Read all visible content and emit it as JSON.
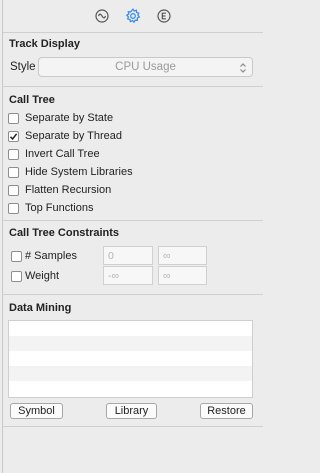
{
  "tabs": [
    {
      "icon": "waveform-icon",
      "active": false
    },
    {
      "icon": "gear-icon",
      "active": true
    },
    {
      "icon": "info-e-icon",
      "active": false
    }
  ],
  "track_display": {
    "title": "Track Display",
    "style_label": "Style",
    "style_value": "CPU Usage"
  },
  "call_tree": {
    "title": "Call Tree",
    "options": [
      {
        "label": "Separate by State",
        "checked": false
      },
      {
        "label": "Separate by Thread",
        "checked": true
      },
      {
        "label": "Invert Call Tree",
        "checked": false
      },
      {
        "label": "Hide System Libraries",
        "checked": false
      },
      {
        "label": "Flatten Recursion",
        "checked": false
      },
      {
        "label": "Top Functions",
        "checked": false
      }
    ]
  },
  "constraints": {
    "title": "Call Tree Constraints",
    "samples_label": "# Samples",
    "samples_min": "0",
    "samples_max": "∞",
    "weight_label": "Weight",
    "weight_min": "-∞",
    "weight_max": "∞"
  },
  "data_mining": {
    "title": "Data Mining",
    "symbol_button": "Symbol",
    "library_button": "Library",
    "restore_button": "Restore"
  },
  "colors": {
    "accent": "#3d8ee6",
    "background": "#ececec"
  }
}
